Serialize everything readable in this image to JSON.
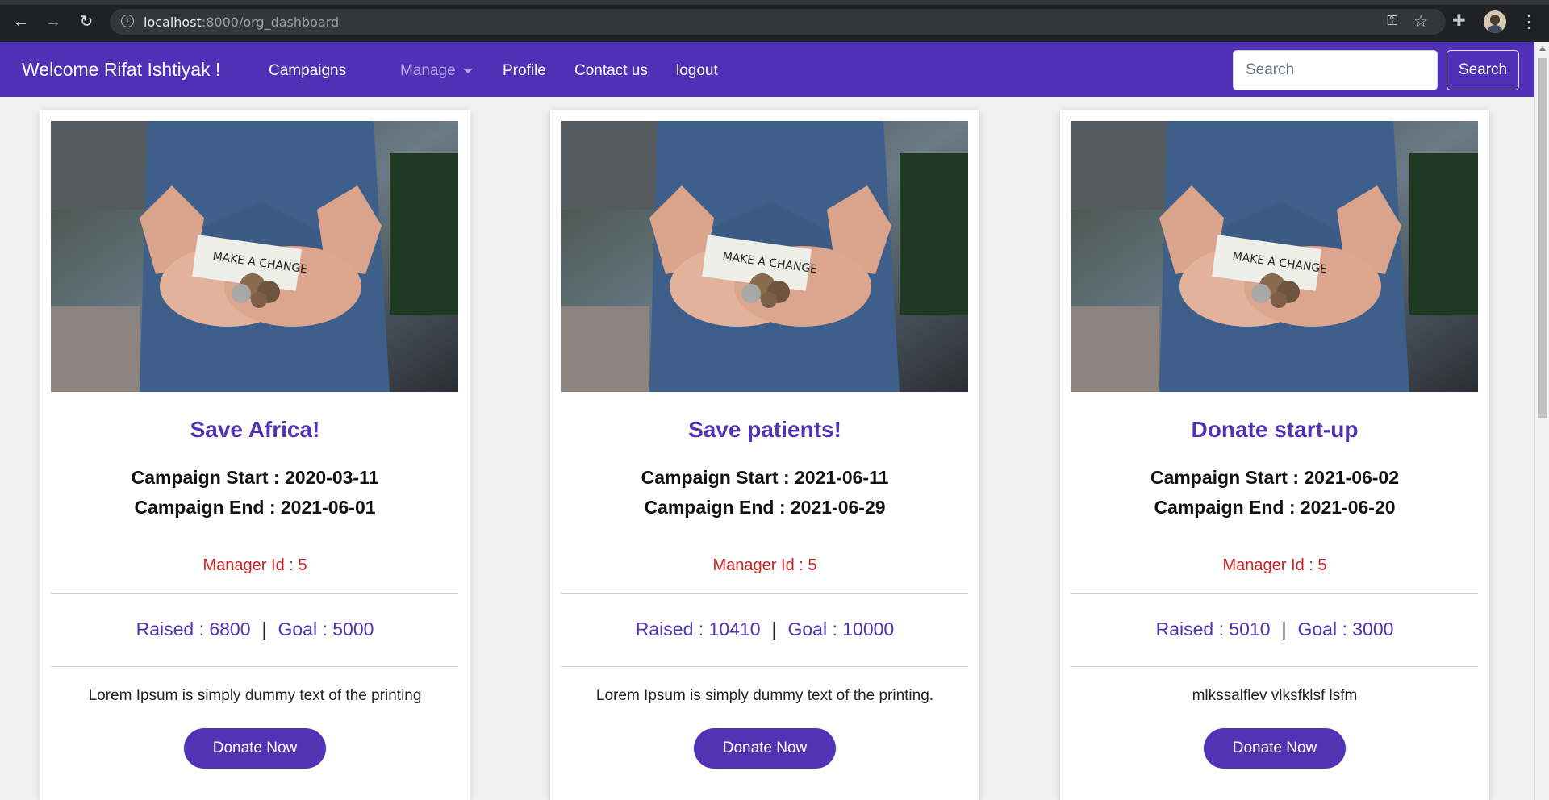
{
  "browser": {
    "url_host": "localhost",
    "url_path": ":8000/org_dashboard"
  },
  "navbar": {
    "brand": "Welcome Rifat Ishtiyak !",
    "links": {
      "campaigns": "Campaigns",
      "manage": "Manage",
      "profile": "Profile",
      "contact": "Contact us",
      "logout": "logout"
    },
    "search_placeholder": "Search",
    "search_button": "Search",
    "color": "#4f30b7"
  },
  "cards": [
    {
      "image_text": "MAKE A CHANGE",
      "title": "Save Africa!",
      "start": "Campaign Start : 2020-03-11",
      "end": "Campaign End : 2021-06-01",
      "manager": "Manager Id : 5",
      "raised": "Raised : 6800",
      "goal": "Goal : 5000",
      "description": "Lorem Ipsum is simply dummy text of the printing",
      "button": "Donate Now"
    },
    {
      "image_text": "MAKE A CHANGE",
      "title": "Save patients!",
      "start": "Campaign Start : 2021-06-11",
      "end": "Campaign End : 2021-06-29",
      "manager": "Manager Id : 5",
      "raised": "Raised : 10410",
      "goal": "Goal : 10000",
      "description": "Lorem Ipsum is simply dummy text of the printing.",
      "button": "Donate Now"
    },
    {
      "image_text": "MAKE A CHANGE",
      "title": "Donate start-up",
      "start": "Campaign Start : 2021-06-02",
      "end": "Campaign End : 2021-06-20",
      "manager": "Manager Id : 5",
      "raised": "Raised : 5010",
      "goal": "Goal : 3000",
      "description": "mlkssalflev vlksfklsf lsfm",
      "button": "Donate Now"
    }
  ],
  "colors": {
    "accent": "#5233b4",
    "manager_text": "#d21f1f"
  }
}
